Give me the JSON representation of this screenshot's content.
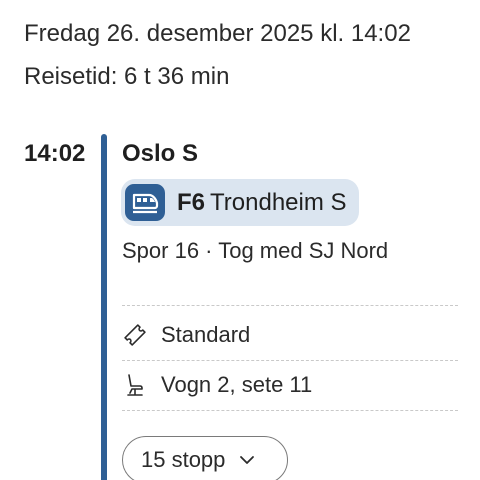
{
  "header": {
    "date_text": "Fredag 26. desember 2025 kl. 14:02",
    "travel_time": "Reisetid: 6 t 36 min"
  },
  "leg": {
    "departure_time": "14:02",
    "station": "Oslo S",
    "line_code": "F6",
    "destination": "Trondheim S",
    "track_info": "Spor 16 · Tog med SJ Nord",
    "ticket_class": "Standard",
    "seat": "Vogn 2, sete 11",
    "stops_label": "15 stopp"
  },
  "colors": {
    "accent": "#2f5f95",
    "chip_bg": "#dbe5f0",
    "divider": "#c9c9c9"
  },
  "icons": {
    "train": "train-icon",
    "ticket": "ticket-icon",
    "seat": "seat-icon",
    "expand": "chevron-down-icon"
  }
}
